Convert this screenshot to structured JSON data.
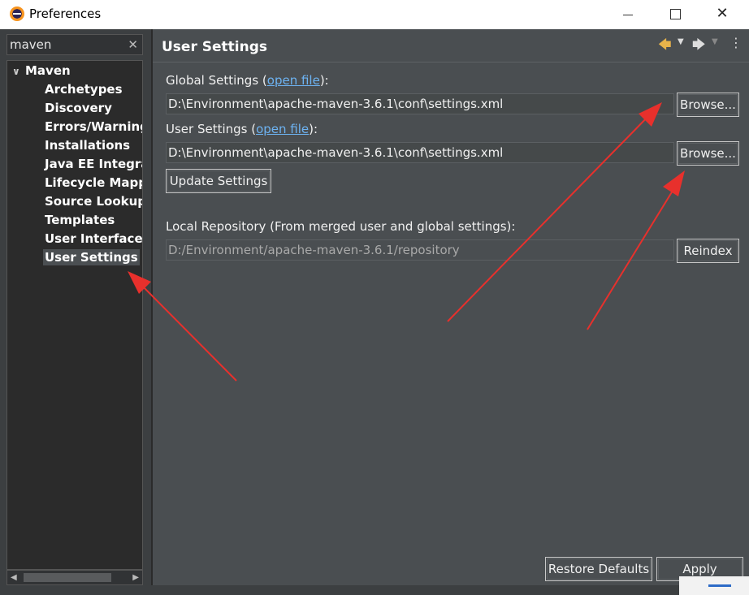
{
  "window": {
    "title": "Preferences"
  },
  "filter": {
    "value": "maven"
  },
  "tree": {
    "root": "Maven",
    "items": [
      "Archetypes",
      "Discovery",
      "Errors/Warnings",
      "Installations",
      "Java EE Integrat",
      "Lifecycle Mappin",
      "Source Lookup",
      "Templates",
      "User Interface",
      "User Settings"
    ],
    "selected": "User Settings"
  },
  "page": {
    "title": "User Settings",
    "global_settings": {
      "label_before": "Global Settings (",
      "link": "open file",
      "label_after": "):",
      "path": "D:\\Environment\\apache-maven-3.6.1\\conf\\settings.xml",
      "browse": "Browse..."
    },
    "user_settings": {
      "label_before": "User Settings (",
      "link": "open file",
      "label_after": "):",
      "path": "D:\\Environment\\apache-maven-3.6.1\\conf\\settings.xml",
      "browse": "Browse..."
    },
    "update_button": "Update Settings",
    "local_repo": {
      "label": "Local Repository (From merged user and global settings):",
      "path": "D:/Environment/apache-maven-3.6.1/repository",
      "reindex": "Reindex"
    },
    "restore_defaults": "Restore Defaults",
    "apply": "Apply"
  },
  "annotation_color": "#e8302c"
}
